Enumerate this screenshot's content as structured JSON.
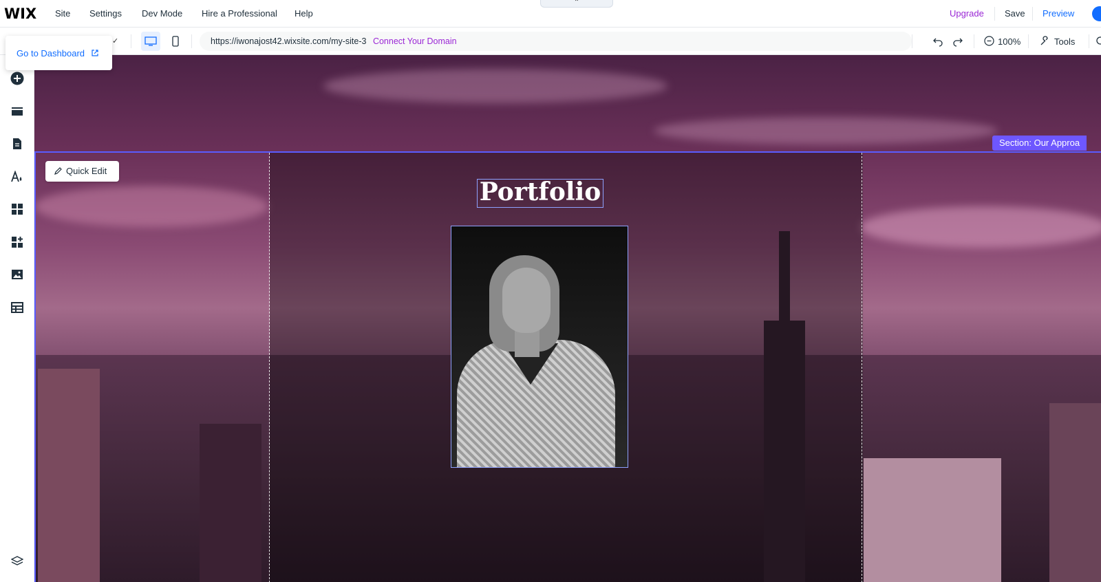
{
  "brand": {
    "logo": "WIX"
  },
  "top_menu": [
    "Site",
    "Settings",
    "Dev Mode",
    "Hire a Professional",
    "Help"
  ],
  "top_right": {
    "upgrade": "Upgrade",
    "save": "Save",
    "preview": "Preview"
  },
  "collapse_glyph": "⌃",
  "dashboard_popup": {
    "label": "Go to Dashboard"
  },
  "address_bar": {
    "url": "https://iwonajost42.wixsite.com/my-site-3",
    "connect": "Connect Your Domain"
  },
  "zoom": {
    "value": "100%"
  },
  "tools": {
    "label": "Tools"
  },
  "canvas": {
    "section_label": "Section: Our Approa",
    "quick_edit": "Quick Edit",
    "heading": "Portfolio"
  },
  "left_rail_icons": [
    "add-icon",
    "sections-icon",
    "pages-icon",
    "theme-icon",
    "apps-icon",
    "add-apps-icon",
    "media-icon",
    "cms-icon",
    "layers-icon"
  ],
  "colors": {
    "accent": "#116dff",
    "upgrade": "#9a27d5",
    "section": "#6e57ff"
  }
}
